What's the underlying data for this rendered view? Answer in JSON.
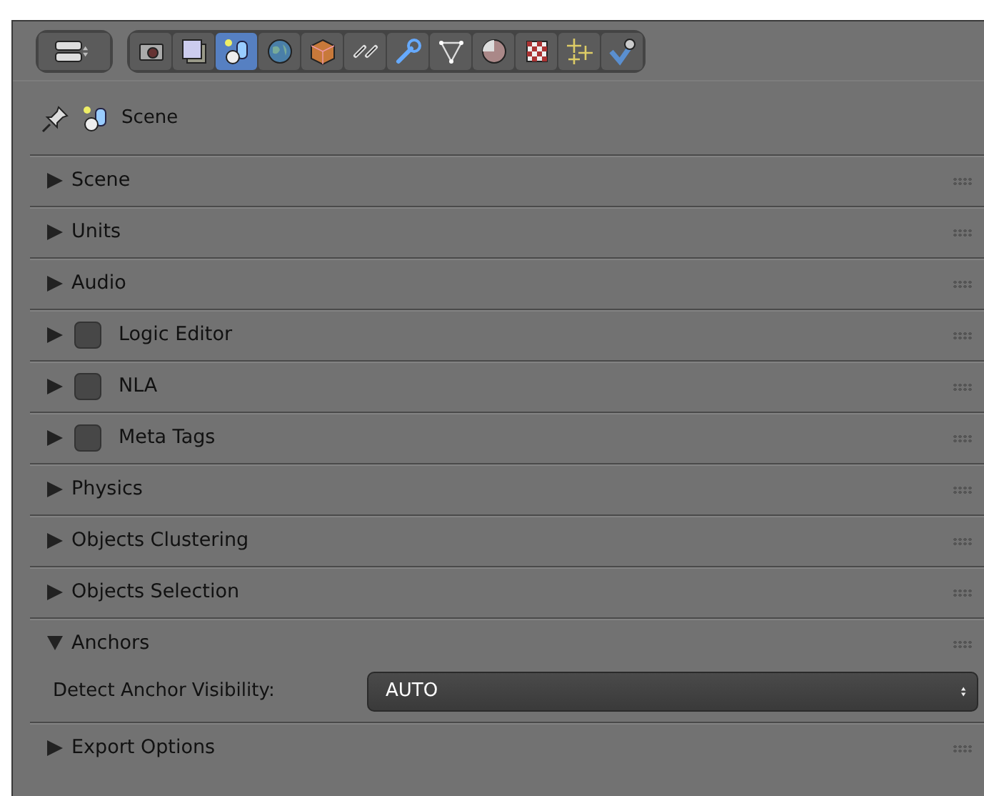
{
  "tabs": [
    {
      "selected": false
    },
    {
      "selected": false
    },
    {
      "selected": true
    },
    {
      "selected": false
    },
    {
      "selected": false
    },
    {
      "selected": false
    },
    {
      "selected": false
    },
    {
      "selected": false
    },
    {
      "selected": false
    },
    {
      "selected": false
    },
    {
      "selected": false
    },
    {
      "selected": false
    }
  ],
  "context": {
    "label": "Scene"
  },
  "panels": [
    {
      "kind": "plain",
      "title": "Scene",
      "expanded": false
    },
    {
      "kind": "plain",
      "title": "Units",
      "expanded": false
    },
    {
      "kind": "plain",
      "title": "Audio",
      "expanded": false
    },
    {
      "kind": "checkbox",
      "title": "Logic Editor",
      "expanded": false,
      "checked": false
    },
    {
      "kind": "checkbox",
      "title": "NLA",
      "expanded": false,
      "checked": false
    },
    {
      "kind": "checkbox",
      "title": "Meta Tags",
      "expanded": false,
      "checked": false
    },
    {
      "kind": "plain",
      "title": "Physics",
      "expanded": false
    },
    {
      "kind": "plain",
      "title": "Objects Clustering",
      "expanded": false
    },
    {
      "kind": "plain",
      "title": "Objects Selection",
      "expanded": false
    },
    {
      "kind": "plain",
      "title": "Anchors",
      "expanded": true,
      "fields": [
        {
          "label": "Detect Anchor Visibility:",
          "value": "AUTO"
        }
      ]
    },
    {
      "kind": "plain",
      "title": "Export Options",
      "expanded": false
    }
  ]
}
